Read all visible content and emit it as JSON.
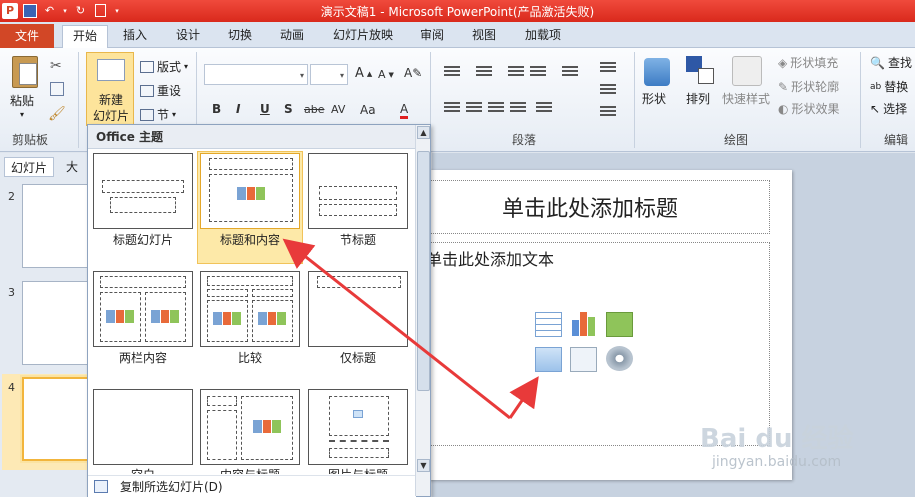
{
  "app": {
    "title": "演示文稿1 - Microsoft PowerPoint(产品激活失败)",
    "logo": "P"
  },
  "tabs": [
    "文件",
    "开始",
    "插入",
    "设计",
    "切换",
    "动画",
    "幻灯片放映",
    "审阅",
    "视图",
    "加载项"
  ],
  "ribbon": {
    "clipboard": {
      "paste": "粘贴",
      "label": "剪贴板"
    },
    "slides": {
      "new_slide_line1": "新建",
      "new_slide_line2": "幻灯片",
      "layout": "版式",
      "reset": "重设",
      "section": "节"
    },
    "font": {
      "bold": "B",
      "italic": "I",
      "underline": "U",
      "shadow": "S",
      "strike": "abe",
      "spacing": "AV",
      "case": "Aa",
      "color": "A"
    },
    "paragraph": {
      "label": "段落"
    },
    "drawing": {
      "shape": "形状",
      "arrange": "排列",
      "quick_styles": "快速样式",
      "fill": "形状填充",
      "outline": "形状轮廓",
      "effect": "形状效果",
      "label": "绘图"
    },
    "editing": {
      "find": "查找",
      "replace": "替换",
      "select": "选择",
      "label": "编辑"
    }
  },
  "left_pane": {
    "tab_slides": "幻灯片",
    "tab_outline": "大",
    "slide_numbers": [
      "2",
      "3",
      "4"
    ]
  },
  "gallery": {
    "header": "Office 主题",
    "layouts": [
      "标题幻灯片",
      "标题和内容",
      "节标题",
      "两栏内容",
      "比较",
      "仅标题",
      "空白",
      "内容与标题",
      "图片与标题"
    ],
    "selected": "标题和内容",
    "footer": "复制所选幻灯片(D)"
  },
  "slide": {
    "title_placeholder": "单击此处添加标题",
    "body_placeholder": "单击此处添加文本"
  },
  "watermark": {
    "brand": "Bai du 经验",
    "url": "jingyan.baidu.com"
  },
  "colors": {
    "accent_red": "#d24726",
    "arrow": "#e83a3a",
    "highlight": "#fde9a8"
  }
}
